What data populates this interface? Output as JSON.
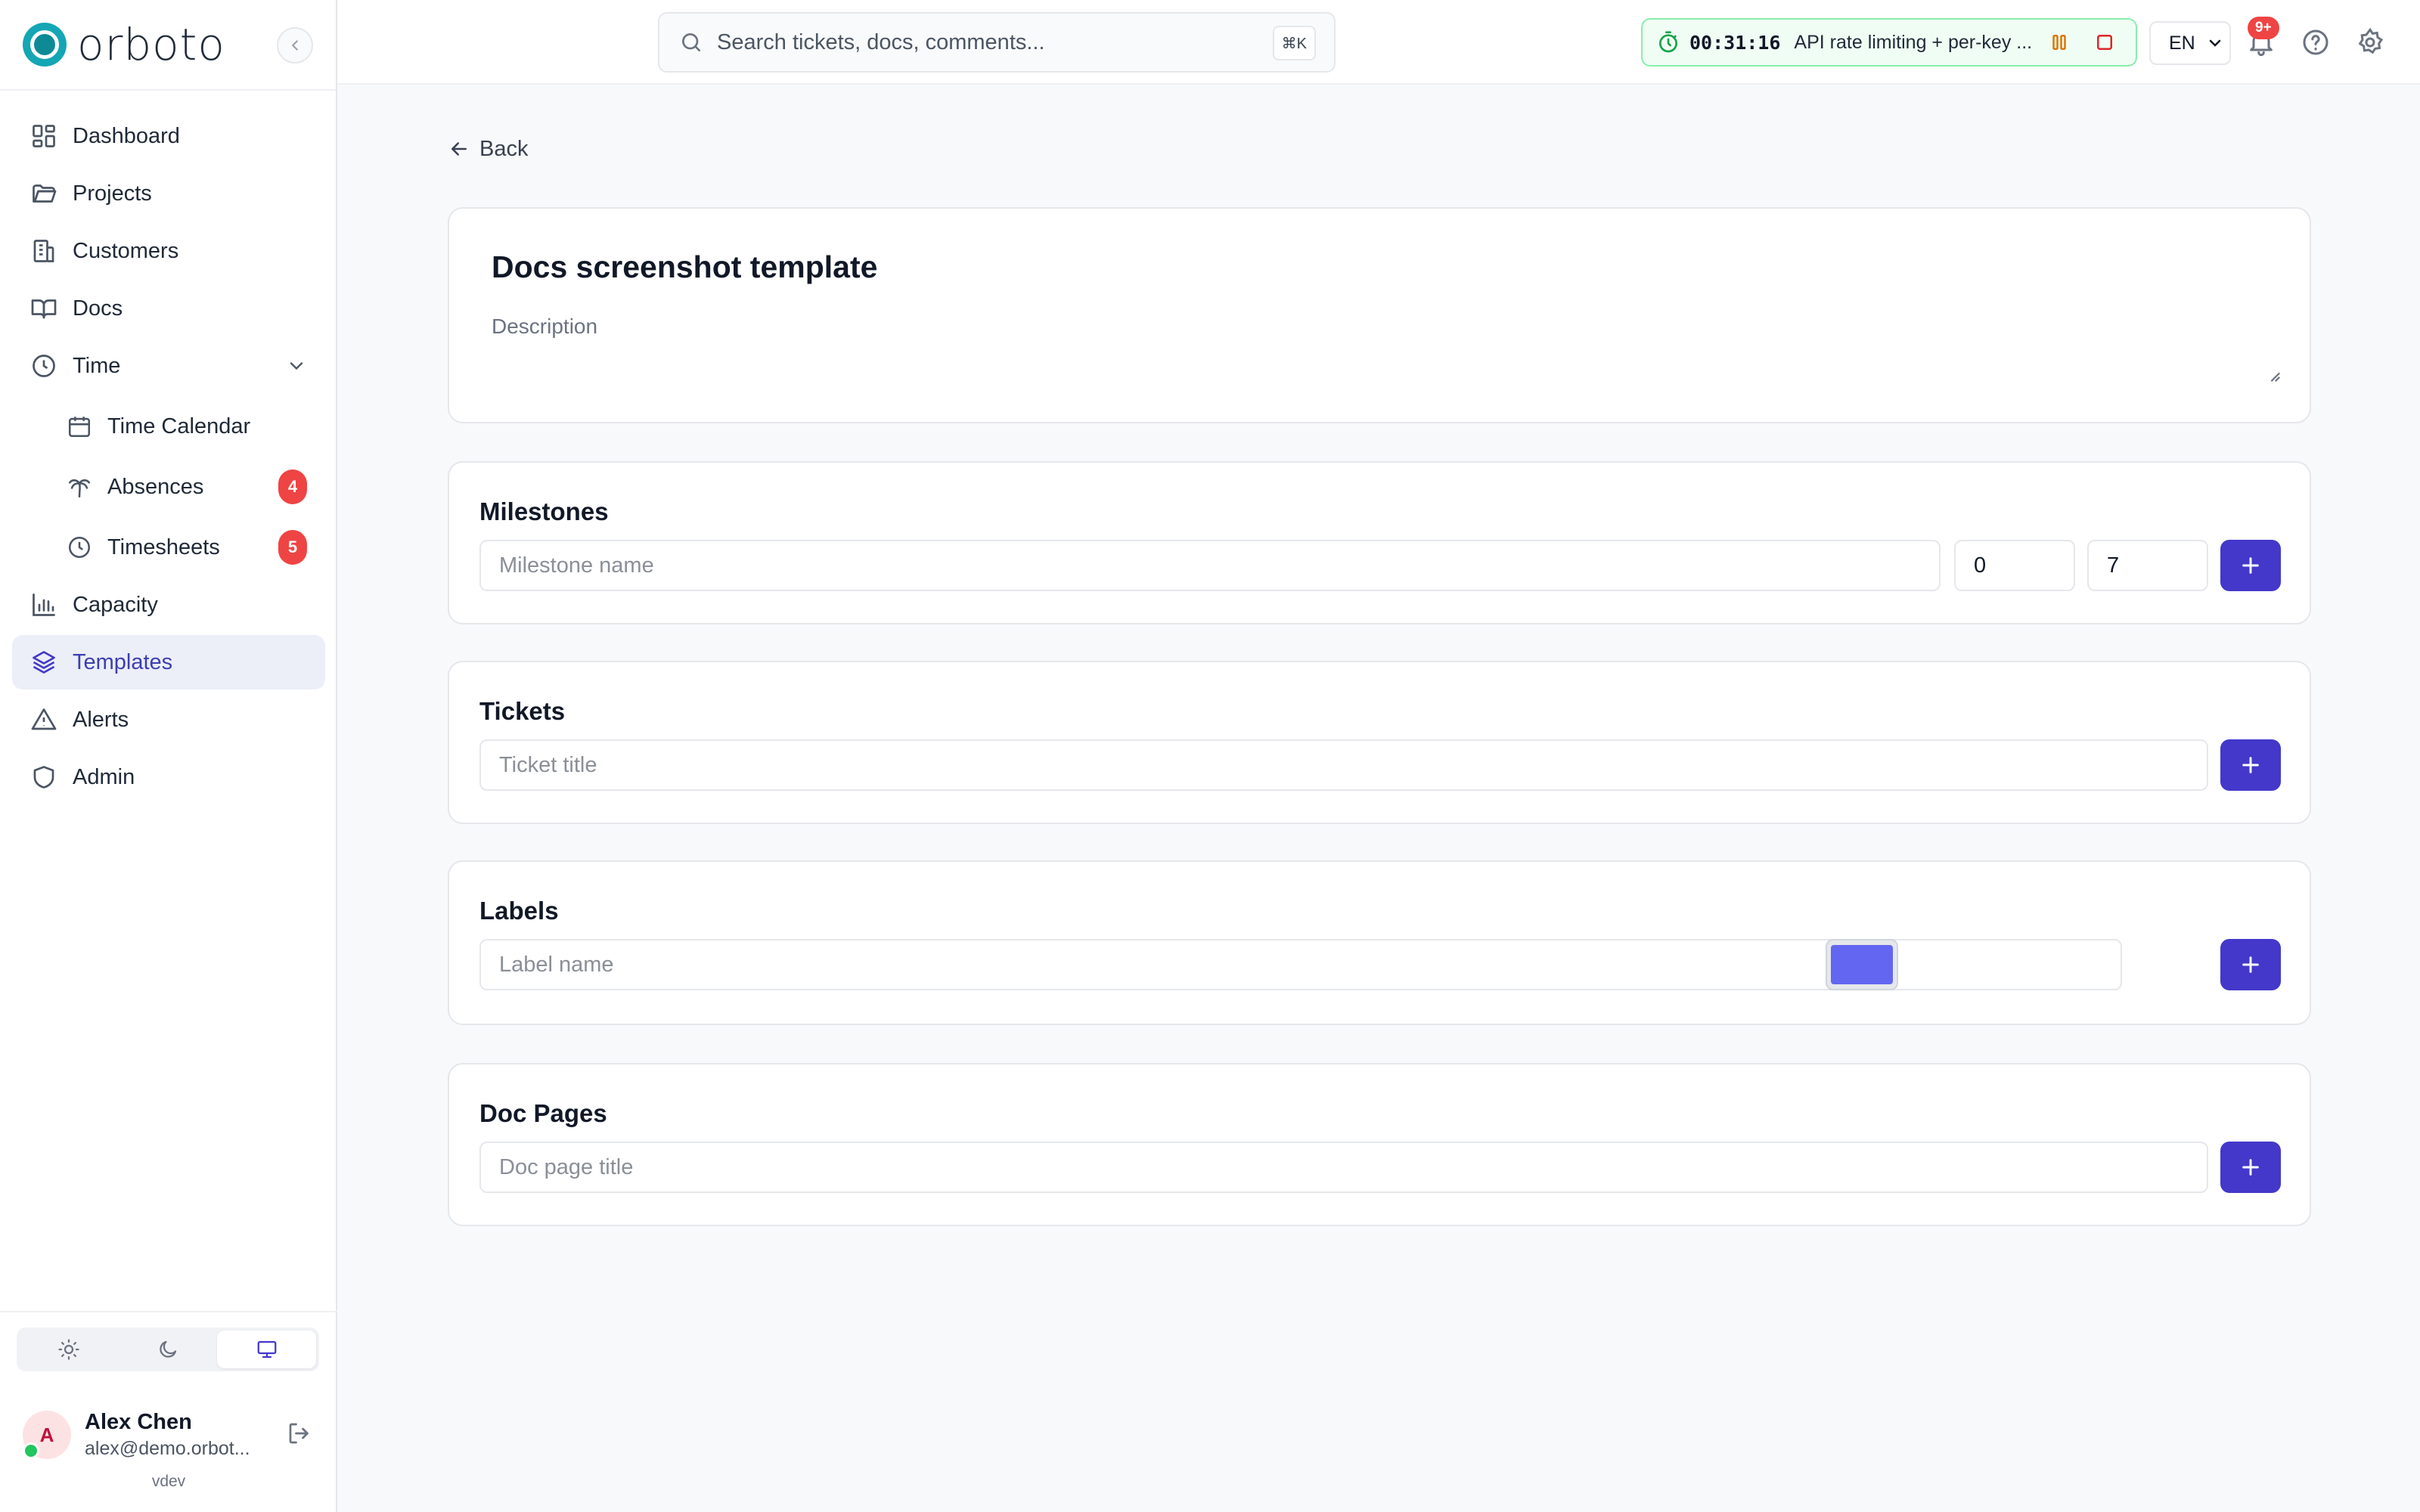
{
  "brand": {
    "name": "orboto"
  },
  "sidebar": {
    "items": [
      {
        "label": "Dashboard",
        "icon": "dashboard-icon"
      },
      {
        "label": "Projects",
        "icon": "folder-icon"
      },
      {
        "label": "Customers",
        "icon": "building-icon"
      },
      {
        "label": "Docs",
        "icon": "book-icon"
      },
      {
        "label": "Time",
        "icon": "clock-icon"
      },
      {
        "label": "Capacity",
        "icon": "bar-chart-icon"
      },
      {
        "label": "Templates",
        "icon": "layers-icon"
      },
      {
        "label": "Alerts",
        "icon": "alert-triangle-icon"
      },
      {
        "label": "Admin",
        "icon": "shield-icon"
      }
    ],
    "time_sub": [
      {
        "label": "Time Calendar",
        "icon": "calendar-icon"
      },
      {
        "label": "Absences",
        "icon": "palm-tree-icon",
        "badge": "4"
      },
      {
        "label": "Timesheets",
        "icon": "clock-icon",
        "badge": "5"
      }
    ],
    "active": "Templates"
  },
  "theme": {
    "selected": "system",
    "options": [
      "light",
      "dark",
      "system"
    ]
  },
  "user": {
    "initial": "A",
    "name": "Alex Chen",
    "email": "alex@demo.orbot...",
    "status": "online"
  },
  "version": "vdev",
  "topbar": {
    "search_placeholder": "Search tickets, docs, comments...",
    "search_shortcut": "⌘K",
    "timer": {
      "time": "00:31:16",
      "label": "API rate limiting + per-key ..."
    },
    "language": "EN",
    "notifications_badge": "9+"
  },
  "back_label": "Back",
  "template": {
    "title": "Docs screenshot template",
    "description_placeholder": "Description",
    "description_value": ""
  },
  "milestones": {
    "title": "Milestones",
    "name_placeholder": "Milestone name",
    "start_value": "0",
    "duration_value": "7"
  },
  "tickets": {
    "title": "Tickets",
    "placeholder": "Ticket title"
  },
  "labels": {
    "title": "Labels",
    "placeholder": "Label name",
    "color": "#6366f1"
  },
  "doc_pages": {
    "title": "Doc Pages",
    "placeholder": "Doc page title"
  },
  "colors": {
    "accent": "#4338ca",
    "brand": "#14a6b4",
    "badge": "#ef4444",
    "timer_border": "#86efac"
  }
}
